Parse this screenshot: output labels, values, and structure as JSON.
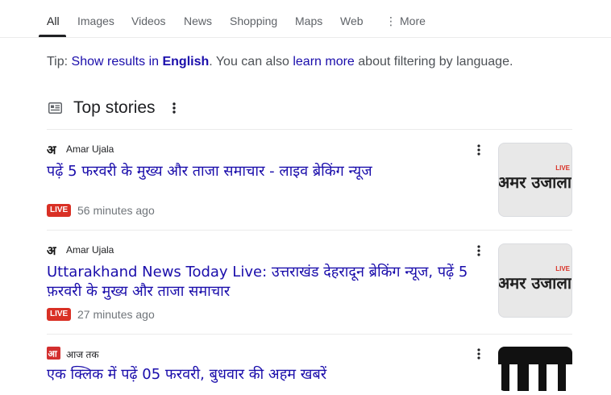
{
  "tabs": [
    {
      "label": "All",
      "active": true
    },
    {
      "label": "Images"
    },
    {
      "label": "Videos"
    },
    {
      "label": "News"
    },
    {
      "label": "Shopping"
    },
    {
      "label": "Maps"
    },
    {
      "label": "Web"
    },
    {
      "label": "More"
    }
  ],
  "tip": {
    "prefix": "Tip: ",
    "show_results": "Show results in ",
    "language": "English",
    "middle": ". You can also ",
    "learn_more": "learn more",
    "suffix": " about filtering by language."
  },
  "section": {
    "title": "Top stories",
    "icon": "newspaper-icon"
  },
  "stories": [
    {
      "source": "Amar Ujala",
      "title": "पढ़ें 5 फरवरी के मुख्य और ताजा समाचार - लाइव ब्रेकिंग न्यूज",
      "live": "LIVE",
      "time": "56 minutes ago",
      "thumb_text": "अमर उजाला",
      "thumb_badge": "LIVE"
    },
    {
      "source": "Amar Ujala",
      "title": "Uttarakhand News Today Live: उत्तराखंड देहरादून ब्रेकिंग न्यूज, पढ़ें 5 फ़रवरी के मुख्य और ताजा समाचार",
      "live": "LIVE",
      "time": "27 minutes ago",
      "thumb_text": "अमर उजाला",
      "thumb_badge": "LIVE"
    },
    {
      "source": "आज तक",
      "title": "एक क्लिक में पढ़ें 05 फरवरी, बुधवार की अहम खबरें"
    }
  ],
  "colors": {
    "link": "#1a0dab",
    "live_badge": "#d93025",
    "divider": "#ebebeb",
    "meta_text": "#70757a"
  }
}
